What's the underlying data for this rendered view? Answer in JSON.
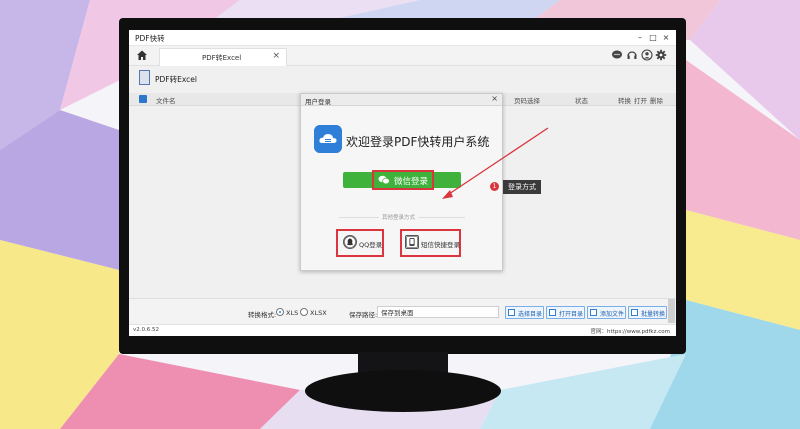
{
  "app": {
    "title": "PDF快转"
  },
  "window_controls": {
    "minimize": "–",
    "maximize": "□",
    "close": "×"
  },
  "tabs": [
    {
      "label": "PDF转Excel",
      "close": "×"
    }
  ],
  "top_icons": [
    "chat-icon",
    "headset-icon",
    "user-icon",
    "gear-icon"
  ],
  "doc": {
    "title": "PDF转Excel"
  },
  "list_header": {
    "filename": "文件名",
    "page_select": "页码选择",
    "status": "状态",
    "convert": "转换",
    "open": "打开",
    "delete": "删除"
  },
  "dialog": {
    "title": "用户登录",
    "close": "×",
    "welcome": "欢迎登录PDF快转用户系统",
    "wechat_login": "微信登录",
    "other_methods": "其他登录方式",
    "qq_login": "QQ登录",
    "sms_login": "短信快捷登录"
  },
  "bottom": {
    "format_label": "转换格式:",
    "format_options": [
      "XLS",
      "XLSX"
    ],
    "format_selected": "XLS",
    "save_label": "保存路径:",
    "save_path": "保存到桌面",
    "buttons": [
      "选择目录",
      "打开目录",
      "添加文件",
      "批量转换"
    ]
  },
  "status": {
    "version": "v2.0.6.52",
    "website": "官网：https://www.pdfkz.com"
  },
  "annotation": {
    "number": "1",
    "label": "登录方式"
  },
  "colors": {
    "accent": "#2f7fd8",
    "wechat_green": "#3fb23c",
    "highlight_red": "#d9363e",
    "monitor": "#0f0f10"
  }
}
